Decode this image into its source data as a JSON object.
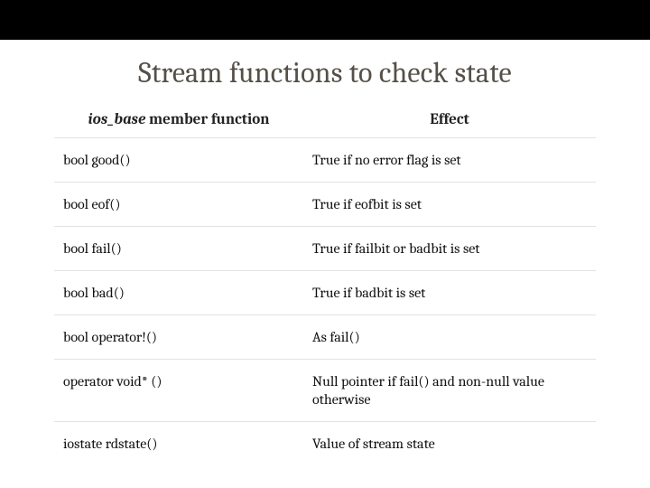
{
  "title": "Stream functions to check state",
  "table": {
    "header": {
      "fn_prefix_italic": "ios_base",
      "fn_suffix": " member function",
      "effect": "Effect"
    },
    "rows": [
      {
        "fn": "bool good()",
        "effect": "True if no error flag is set"
      },
      {
        "fn": "bool eof()",
        "effect": "True if eofbit is set"
      },
      {
        "fn": "bool fail()",
        "effect": "True if failbit or badbit is set"
      },
      {
        "fn": "bool bad()",
        "effect": "True if badbit is set"
      },
      {
        "fn": "bool operator!()",
        "effect": "As fail()"
      },
      {
        "fn": "operator void* ()",
        "effect": "Null pointer if fail() and non-null value otherwise"
      },
      {
        "fn": "iostate rdstate()",
        "effect": "Value of stream state"
      }
    ]
  }
}
